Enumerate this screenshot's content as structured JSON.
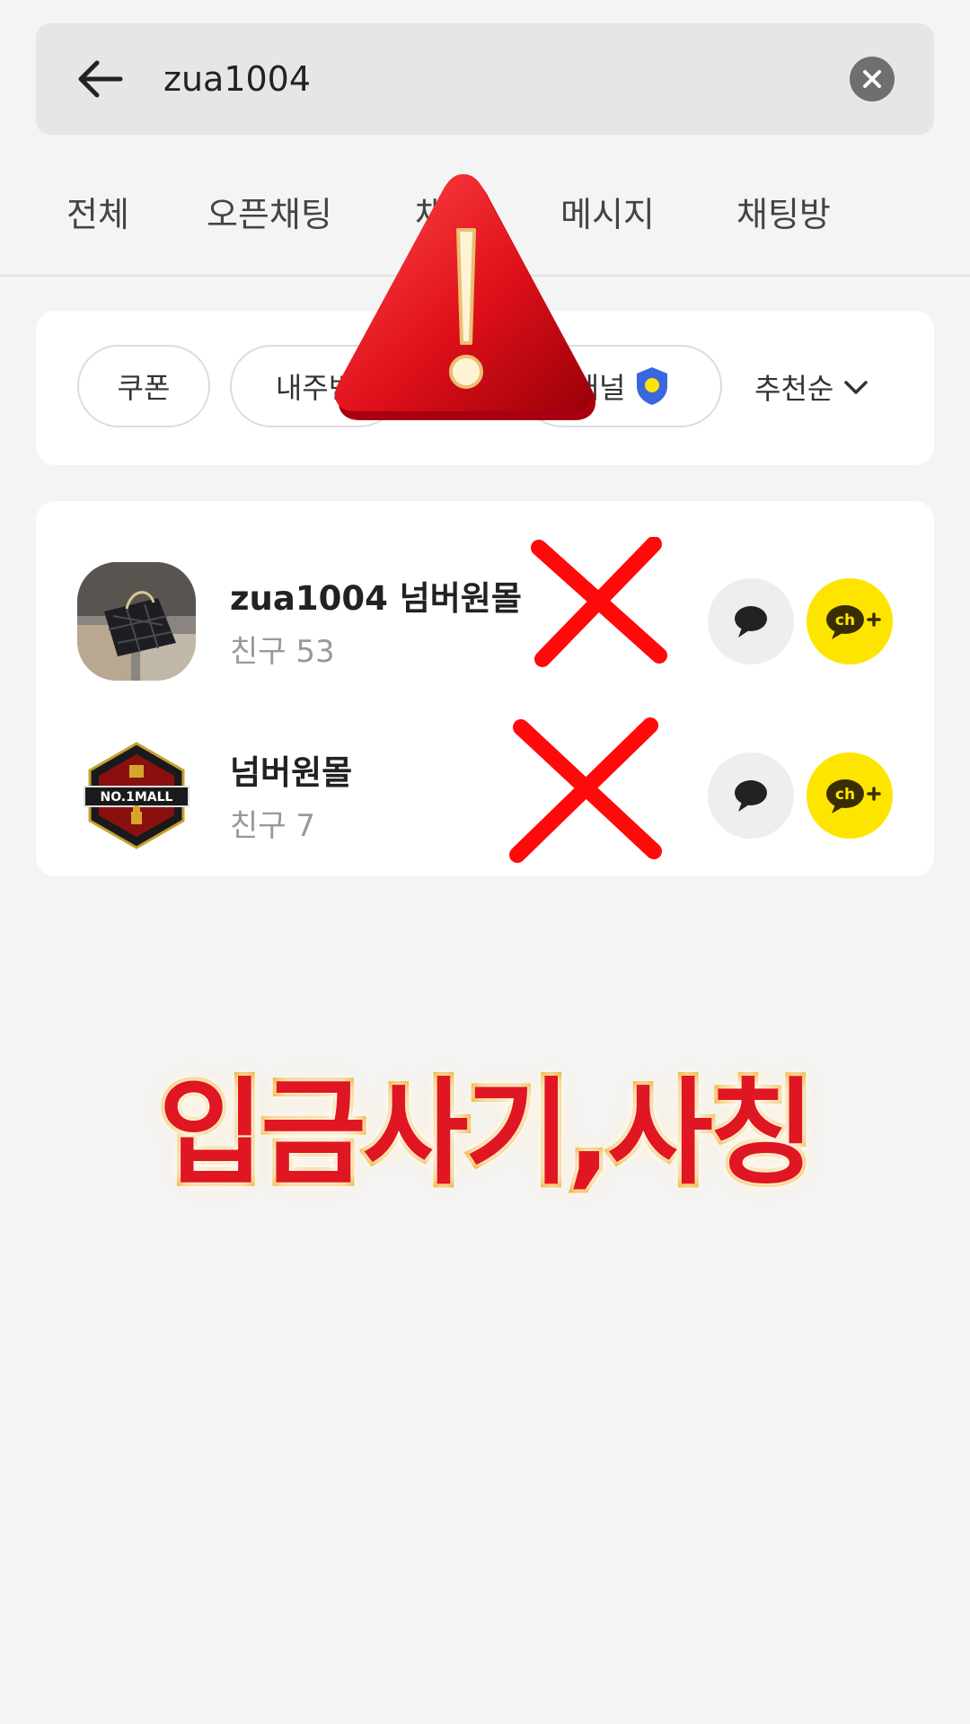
{
  "search": {
    "query": "zua1004"
  },
  "tabs": [
    {
      "label": "전체"
    },
    {
      "label": "오픈채팅"
    },
    {
      "label": "채널"
    },
    {
      "label": "메시지"
    },
    {
      "label": "채팅방"
    }
  ],
  "filters": {
    "chips": [
      {
        "label": "쿠폰"
      },
      {
        "label": "내주변"
      },
      {
        "label": "채널"
      }
    ],
    "sort_label": "추천순"
  },
  "results": [
    {
      "name": "zua1004 넘버원몰",
      "friends": "친구 53"
    },
    {
      "name": "넘버원몰",
      "friends": "친구 7"
    }
  ],
  "logo_text": "NO.1MALL",
  "overlay": {
    "text": "입금사기,사칭"
  },
  "colors": {
    "channel_yellow": "#fee500",
    "warning_red": "#e01622",
    "x_red": "#ff0000"
  }
}
